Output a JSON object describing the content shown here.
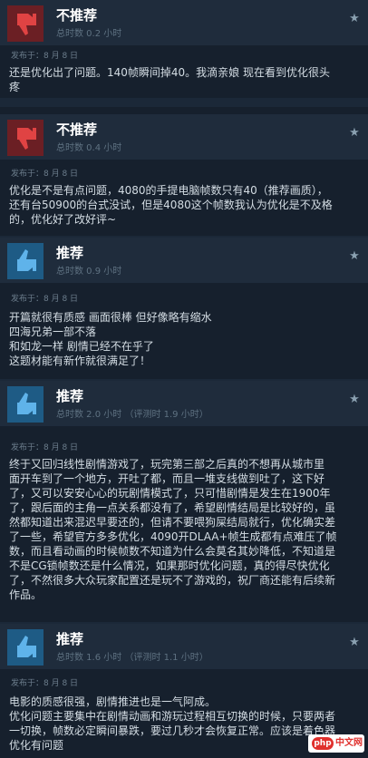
{
  "reviews": [
    {
      "verdict": "不推荐",
      "hours": "总时数 0.2 小时",
      "posted": "发布于：8 月 8 日",
      "lines": [
        "还是优化出了问题。140帧瞬间掉40。我滴亲娘 现在看到优化很头",
        "疼"
      ],
      "sentiment": "negative"
    },
    {
      "verdict": "不推荐",
      "hours": "总时数 0.4 小时",
      "posted": "发布于：8 月 8 日",
      "lines": [
        "优化是不是有点问题，4080的手提电脑帧数只有40（推荐画质），",
        "还有台50900的台式没试，但是4080这个帧数我认为优化是不及格",
        "的，优化好了改好评~"
      ],
      "sentiment": "negative"
    },
    {
      "verdict": "推荐",
      "hours": "总时数 0.9 小时",
      "posted": "发布于：8 月 8 日",
      "lines": [
        "开篇就很有质感 画面很棒 但好像略有缩水",
        "四海兄弟一部不落",
        "和如龙一样 剧情已经不在乎了",
        "这题材能有新作就很满足了！"
      ],
      "sentiment": "positive"
    },
    {
      "verdict": "推荐",
      "hours": "总时数 2.0 小时 （评测时 1.9 小时）",
      "posted": "发布于：8 月 8 日",
      "lines": [
        "终于又回归线性剧情游戏了，玩完第三部之后真的不想再从城市里",
        "面开车到了一个地方，开吐了都，而且一堆支线做到吐了，这下好",
        "了，又可以安安心心的玩剧情模式了，只可惜剧情是发生在1900年",
        "了，跟后面的主角一点关系都没有了，希望剧情结局是比较好的，虽",
        "然都知道出来混迟早要还的，但请不要喂狗屎结局就行，优化确实差",
        "了一些，希望官方多多优化，4090开DLAA+帧生成都有点难压了帧",
        "数，而且看动画的时候帧数不知道为什么会莫名其妙降低，不知道是",
        "不是CG锁帧数还是什么情况，如果那时优化问题，真的得尽快优化",
        "了，不然很多大众玩家配置还是玩不了游戏的，祝厂商还能有后续新",
        "作品。"
      ],
      "sentiment": "positive"
    },
    {
      "verdict": "推荐",
      "hours": "总时数 1.6 小时 （评测时 1.1 小时）",
      "posted": "发布于：8 月 8 日",
      "lines": [
        "电影的质感很强，剧情推进也是一气阿成。",
        "优化问题主要集中在剧情动画和游玩过程相互切换的时候，只要两者",
        "一切换，帧数必定瞬间暴跌，要过几秒才会恢复正常。应该是着色器",
        "优化有问题"
      ],
      "sentiment": "positive"
    }
  ],
  "watermark": {
    "badge": "php",
    "text": "中文网"
  },
  "colors": {
    "negative": "#6b1f24",
    "positive": "#1e5b85",
    "thumb_negative": "#e04343",
    "thumb_positive": "#5fb3ea"
  },
  "icons": {
    "thumbs_down": "thumbs-down-icon",
    "thumbs_up": "thumbs-up-icon",
    "star": "star-icon"
  }
}
